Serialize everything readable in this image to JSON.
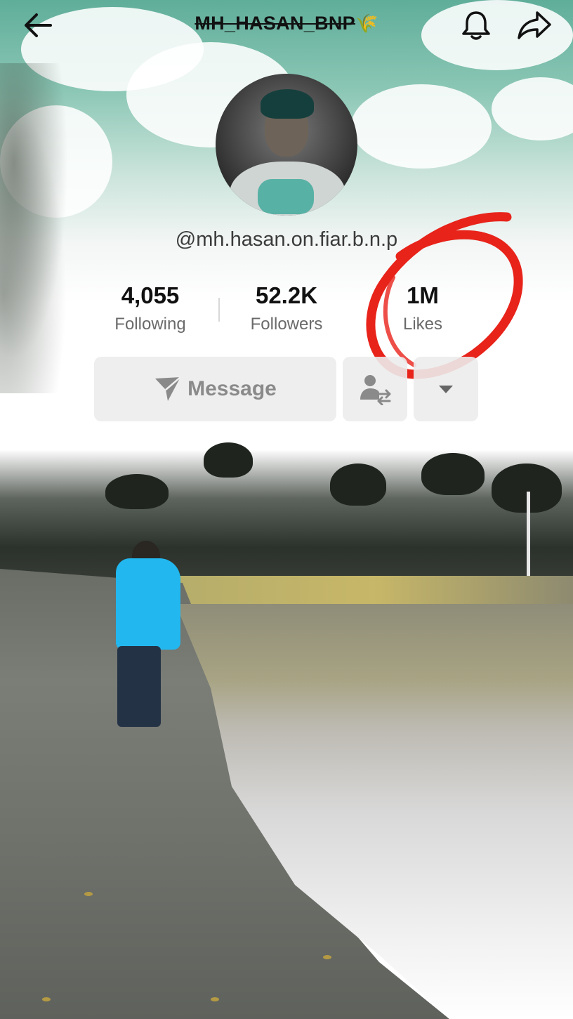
{
  "header": {
    "title": "MH_HASAN_BNP",
    "title_emoji": "🌾",
    "back_icon": "arrow-left-icon",
    "bell_icon": "bell-icon",
    "share_icon": "share-arrow-icon"
  },
  "profile": {
    "handle": "@mh.hasan.on.fiar.b.n.p",
    "avatar_icon": "avatar-photo"
  },
  "stats": [
    {
      "value": "4,055",
      "label": "Following"
    },
    {
      "value": "52.2K",
      "label": "Followers"
    },
    {
      "value": "1M",
      "label": "Likes"
    }
  ],
  "actions": {
    "message_label": "Message",
    "message_icon": "send-icon",
    "add_friend_icon": "user-swap-icon",
    "more_icon": "caret-down-icon"
  },
  "colors": {
    "annotation_red": "#e8231a",
    "button_bg": "#ececec",
    "shirt_blue": "#22b7ef"
  }
}
